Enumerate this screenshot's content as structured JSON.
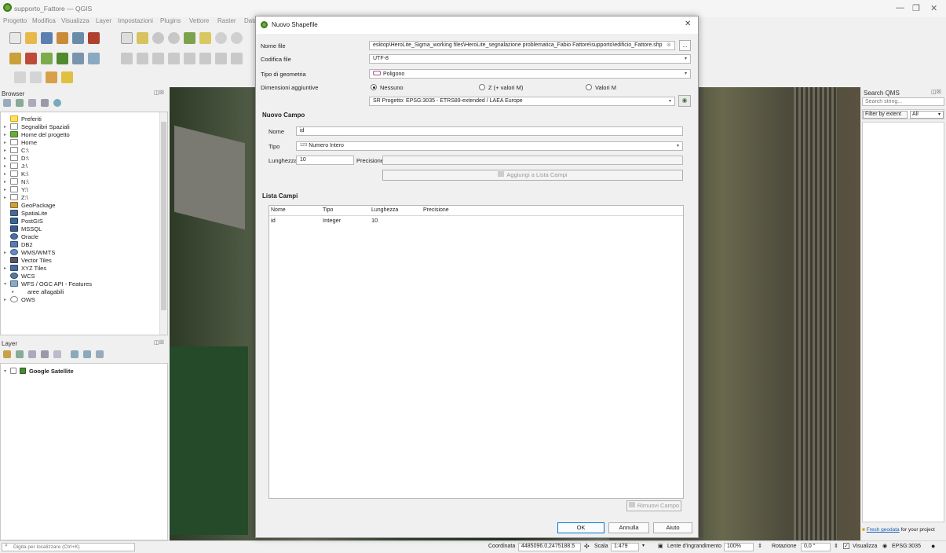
{
  "app": {
    "title": "supporto_Fattore — QGIS"
  },
  "menubar": [
    "Progetto",
    "Modifica",
    "Visualizza",
    "Layer",
    "Impostazioni",
    "Plugins",
    "Vettore",
    "Raster",
    "Data"
  ],
  "browser": {
    "title": "Browser",
    "items": [
      "Preferiti",
      "Segnalibri Spaziali",
      "Home del progetto",
      "Home",
      "C:\\",
      "D:\\",
      "J:\\",
      "K:\\",
      "N:\\",
      "Y:\\",
      "Z:\\",
      "GeoPackage",
      "SpatiaLite",
      "PostGIS",
      "MSSQL",
      "Oracle",
      "DB2",
      "WMS/WMTS",
      "Vector Tiles",
      "XYZ Tiles",
      "WCS",
      "WFS / OGC API - Features",
      "aree allagabili",
      "OWS"
    ]
  },
  "layers": {
    "title": "Layer",
    "items": [
      "Google Satellite"
    ]
  },
  "qms": {
    "title": "Search QMS",
    "placeholder": "Search string...",
    "filter_label": "Filter by extent",
    "filter_value": "All",
    "footer_link": "Fresh geodata",
    "footer_text": "for your project"
  },
  "dialog": {
    "title": "Nuovo Shapefile",
    "file_label": "Nome file",
    "file_value": "esktop\\HeroLite_Sigma_working files\\HeroLite_segnalazione problematica_Fabio Fattore\\supporto\\edificio_Fattore.shp",
    "file_browse": "...",
    "encoding_label": "Codifica file",
    "encoding_value": "UTF-8",
    "geom_label": "Tipo di geometria",
    "geom_value": "Poligono",
    "dims_label": "Dimensioni aggiuntive",
    "dims_options": [
      "Nessuno",
      "Z (+ valori M)",
      "Valori M"
    ],
    "crs_value": "SR Progetto: EPSG:3035 - ETRS89-extended / LAEA Europe",
    "new_field": {
      "section": "Nuovo Campo",
      "name_label": "Nome",
      "name_value": "id",
      "type_label": "Tipo",
      "type_value": "Numero Intero",
      "type_icon_text": "123",
      "length_label": "Lunghezza",
      "length_value": "10",
      "precision_label": "Precisione",
      "precision_value": "",
      "add_button": "Aggiungi a Lista Campi"
    },
    "field_list": {
      "section": "Lista Campi",
      "columns": [
        "Nome",
        "Tipo",
        "Lunghezza",
        "Precisione"
      ],
      "rows": [
        [
          "id",
          "Integer",
          "10",
          ""
        ]
      ],
      "remove_button": "Rimuovi Campo"
    },
    "ok": "OK",
    "cancel": "Annulla",
    "help": "Aiuto"
  },
  "statusbar": {
    "locator_placeholder": "Digita per localizzare (Ctrl+K)",
    "coord_label": "Coordinata",
    "coord_value": "4485096.0,2475188.5",
    "scale_label": "Scala",
    "scale_value": "1:479",
    "magnifier_label": "Lente d'ingrandimento",
    "magnifier_value": "100%",
    "rotation_label": "Rotazione",
    "rotation_value": "0,0 °",
    "render_label": "Visualizza",
    "crs": "EPSG:3035"
  }
}
